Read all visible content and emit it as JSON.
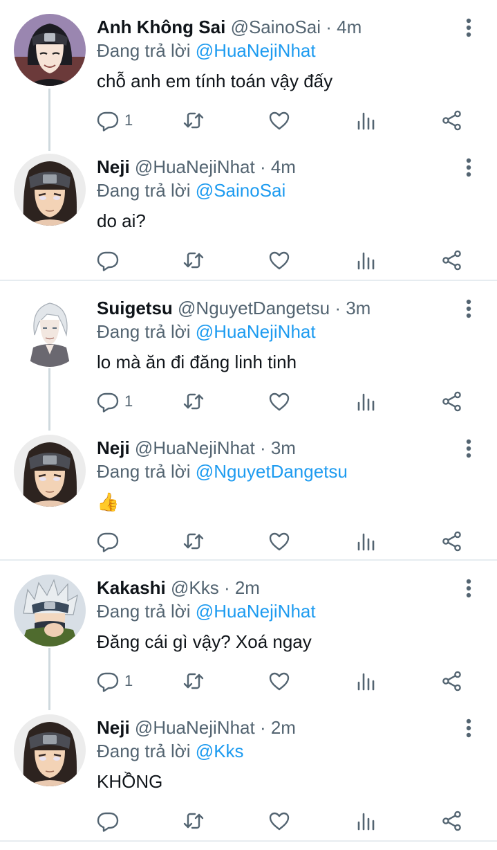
{
  "colors": {
    "mention": "#1d9bf0",
    "meta": "#536471",
    "icon": "#536471",
    "separator": "#e6ecf0",
    "thread_line": "#cfd9de"
  },
  "icons": {
    "reply": "comment-bubble",
    "retweet": "retweet-arrows",
    "like": "heart",
    "stats": "bar-chart",
    "share": "share-nodes",
    "more": "vertical-dots"
  },
  "tweets": [
    {
      "name": "Anh Không Sai",
      "handle": "@SainoSai",
      "time": "· 4m",
      "reply_prefix": "Đang trả lời",
      "reply_to": "@HuaNejiNhat",
      "text": "chỗ anh em tính toán vậy đấy",
      "reply_count": "1",
      "avatar": "sai"
    },
    {
      "name": "Neji",
      "handle": "@HuaNejiNhat",
      "time": "· 4m",
      "reply_prefix": "Đang trả lời",
      "reply_to": "@SainoSai",
      "text": "do ai?",
      "reply_count": "",
      "avatar": "neji"
    },
    {
      "name": "Suigetsu",
      "handle": "@NguyetDangetsu",
      "time": "· 3m",
      "reply_prefix": "Đang trả lời",
      "reply_to": "@HuaNejiNhat",
      "text": "lo mà ăn đi đăng linh tinh",
      "reply_count": "1",
      "avatar": "suigetsu"
    },
    {
      "name": "Neji",
      "handle": "@HuaNejiNhat",
      "time": "· 3m",
      "reply_prefix": "Đang trả lời",
      "reply_to": "@NguyetDangetsu",
      "text": "👍",
      "reply_count": "",
      "avatar": "neji"
    },
    {
      "name": "Kakashi",
      "handle": "@Kks",
      "time": "· 2m",
      "reply_prefix": "Đang trả lời",
      "reply_to": "@HuaNejiNhat",
      "text": "Đăng cái gì vậy? Xoá ngay",
      "reply_count": "1",
      "avatar": "kakashi"
    },
    {
      "name": "Neji",
      "handle": "@HuaNejiNhat",
      "time": "· 2m",
      "reply_prefix": "Đang trả lời",
      "reply_to": "@Kks",
      "text": "KHỒNG",
      "reply_count": "",
      "avatar": "neji"
    }
  ]
}
